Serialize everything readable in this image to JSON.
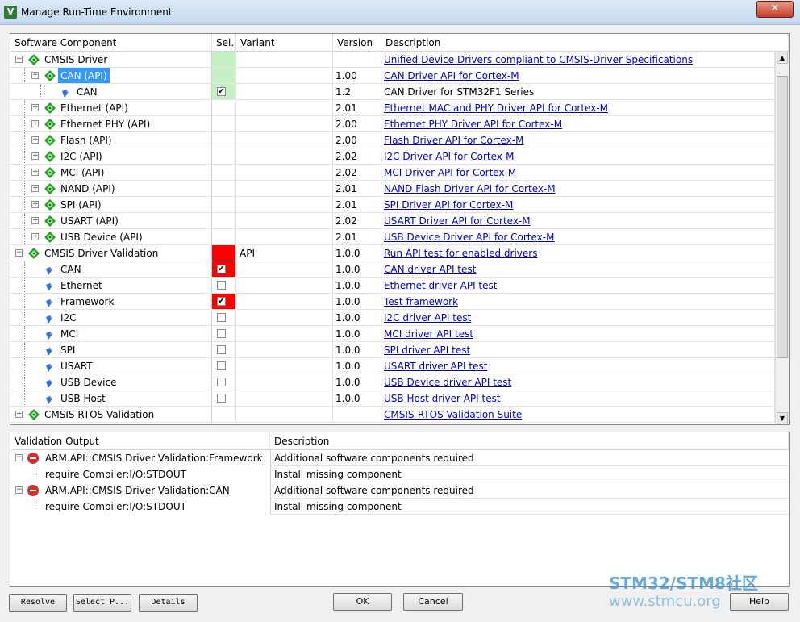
{
  "window": {
    "title": "Manage Run-Time Environment",
    "app_icon_letter": "V",
    "close_glyph": "✕"
  },
  "components": {
    "headers": {
      "component": "Software Component",
      "sel": "Sel.",
      "variant": "Variant",
      "version": "Version",
      "description": "Description"
    },
    "rows": [
      {
        "name": "CMSIS Driver",
        "level": 0,
        "expander": "−",
        "icon": "package",
        "sel": "",
        "sel_bg": "green",
        "variant": "",
        "version": "",
        "description": "Unified Device Drivers compliant to CMSIS-Driver Specifications",
        "link": true
      },
      {
        "name": "CAN (API)",
        "level": 1,
        "expander": "−",
        "icon": "package",
        "selected": true,
        "sel": "",
        "sel_bg": "green",
        "variant": "",
        "version": "1.00",
        "description": "CAN Driver API for Cortex-M",
        "link": true
      },
      {
        "name": "CAN",
        "level": 2,
        "expander": "",
        "icon": "leaf",
        "sel": "✔",
        "sel_bg": "green",
        "variant": "",
        "version": "1.2",
        "description": "CAN Driver for STM32F1 Series",
        "link": false
      },
      {
        "name": "Ethernet (API)",
        "level": 1,
        "expander": "+",
        "icon": "package",
        "sel": "",
        "sel_bg": "",
        "variant": "",
        "version": "2.01",
        "description": "Ethernet MAC and PHY Driver API for Cortex-M",
        "link": true
      },
      {
        "name": "Ethernet PHY (API)",
        "level": 1,
        "expander": "+",
        "icon": "package",
        "sel": "",
        "sel_bg": "",
        "variant": "",
        "version": "2.00",
        "description": "Ethernet PHY Driver API for Cortex-M",
        "link": true
      },
      {
        "name": "Flash (API)",
        "level": 1,
        "expander": "+",
        "icon": "package",
        "sel": "",
        "sel_bg": "",
        "variant": "",
        "version": "2.00",
        "description": "Flash Driver API for Cortex-M",
        "link": true
      },
      {
        "name": "I2C (API)",
        "level": 1,
        "expander": "+",
        "icon": "package",
        "sel": "",
        "sel_bg": "",
        "variant": "",
        "version": "2.02",
        "description": "I2C Driver API for Cortex-M",
        "link": true
      },
      {
        "name": "MCI (API)",
        "level": 1,
        "expander": "+",
        "icon": "package",
        "sel": "",
        "sel_bg": "",
        "variant": "",
        "version": "2.02",
        "description": "MCI Driver API for Cortex-M",
        "link": true
      },
      {
        "name": "NAND (API)",
        "level": 1,
        "expander": "+",
        "icon": "package",
        "sel": "",
        "sel_bg": "",
        "variant": "",
        "version": "2.01",
        "description": "NAND Flash Driver API for Cortex-M",
        "link": true
      },
      {
        "name": "SPI (API)",
        "level": 1,
        "expander": "+",
        "icon": "package",
        "sel": "",
        "sel_bg": "",
        "variant": "",
        "version": "2.01",
        "description": "SPI Driver API for Cortex-M",
        "link": true
      },
      {
        "name": "USART (API)",
        "level": 1,
        "expander": "+",
        "icon": "package",
        "sel": "",
        "sel_bg": "",
        "variant": "",
        "version": "2.02",
        "description": "USART Driver API for Cortex-M",
        "link": true
      },
      {
        "name": "USB Device (API)",
        "level": 1,
        "expander": "+",
        "icon": "package",
        "sel": "",
        "sel_bg": "",
        "variant": "",
        "version": "2.01",
        "description": "USB Device Driver API for Cortex-M",
        "link": true
      },
      {
        "name": "CMSIS Driver Validation",
        "level": 0,
        "expander": "−",
        "icon": "package",
        "sel": "",
        "sel_bg": "red",
        "variant": "API",
        "version": "1.0.0",
        "description": "Run API test for enabled drivers",
        "link": true
      },
      {
        "name": "CAN",
        "level": 1,
        "expander": "",
        "icon": "leaf",
        "sel": "✔",
        "sel_bg": "red",
        "variant": "",
        "version": "1.0.0",
        "description": "CAN driver API test",
        "link": true
      },
      {
        "name": "Ethernet",
        "level": 1,
        "expander": "",
        "icon": "leaf",
        "sel": "",
        "sel_bg": "",
        "variant": "",
        "version": "1.0.0",
        "description": "Ethernet driver API test",
        "link": true
      },
      {
        "name": "Framework",
        "level": 1,
        "expander": "",
        "icon": "leaf",
        "sel": "✔",
        "sel_bg": "red",
        "variant": "",
        "version": "1.0.0",
        "description": "Test framework",
        "link": true
      },
      {
        "name": "I2C",
        "level": 1,
        "expander": "",
        "icon": "leaf",
        "sel": "",
        "sel_bg": "",
        "variant": "",
        "version": "1.0.0",
        "description": "I2C driver API test",
        "link": true
      },
      {
        "name": "MCI",
        "level": 1,
        "expander": "",
        "icon": "leaf",
        "sel": "",
        "sel_bg": "",
        "variant": "",
        "version": "1.0.0",
        "description": "MCI driver API test",
        "link": true
      },
      {
        "name": "SPI",
        "level": 1,
        "expander": "",
        "icon": "leaf",
        "sel": "",
        "sel_bg": "",
        "variant": "",
        "version": "1.0.0",
        "description": "SPI driver API test",
        "link": true
      },
      {
        "name": "USART",
        "level": 1,
        "expander": "",
        "icon": "leaf",
        "sel": "",
        "sel_bg": "",
        "variant": "",
        "version": "1.0.0",
        "description": "USART driver API test",
        "link": true
      },
      {
        "name": "USB Device",
        "level": 1,
        "expander": "",
        "icon": "leaf",
        "sel": "",
        "sel_bg": "",
        "variant": "",
        "version": "1.0.0",
        "description": "USB Device driver API test",
        "link": true
      },
      {
        "name": "USB Host",
        "level": 1,
        "expander": "",
        "icon": "leaf",
        "sel": "",
        "sel_bg": "",
        "variant": "",
        "version": "1.0.0",
        "description": "USB Host driver API test",
        "link": true
      },
      {
        "name": "CMSIS RTOS Validation",
        "level": 0,
        "expander": "+",
        "icon": "package",
        "sel": "",
        "sel_bg": "",
        "variant": "",
        "version": "",
        "description": "CMSIS-RTOS Validation Suite",
        "link": true
      }
    ]
  },
  "validation": {
    "headers": {
      "output": "Validation Output",
      "description": "Description"
    },
    "rows": [
      {
        "name": "ARM.API::CMSIS Driver Validation:Framework",
        "level": 0,
        "icon": "error",
        "description": "Additional software components required"
      },
      {
        "name": "require Compiler:I/O:STDOUT",
        "level": 1,
        "icon": "",
        "description": "Install missing component"
      },
      {
        "name": "ARM.API::CMSIS Driver Validation:CAN",
        "level": 0,
        "icon": "error",
        "description": "Additional software components required"
      },
      {
        "name": "require Compiler:I/O:STDOUT",
        "level": 1,
        "icon": "",
        "description": "Install missing component"
      }
    ]
  },
  "buttons": {
    "resolve": "Resolve",
    "select_packs": "Select P...",
    "details": "Details",
    "ok": "OK",
    "cancel": "Cancel",
    "help": "Help"
  },
  "watermark": {
    "line1": "STM32/STM8社区",
    "line2": "www.stmcu.org"
  },
  "colors": {
    "sel_green": "#c6efc6",
    "sel_red": "#ff0000",
    "link": "#0000cc",
    "selection": "#3399ff",
    "package_icon": "#22a022"
  }
}
